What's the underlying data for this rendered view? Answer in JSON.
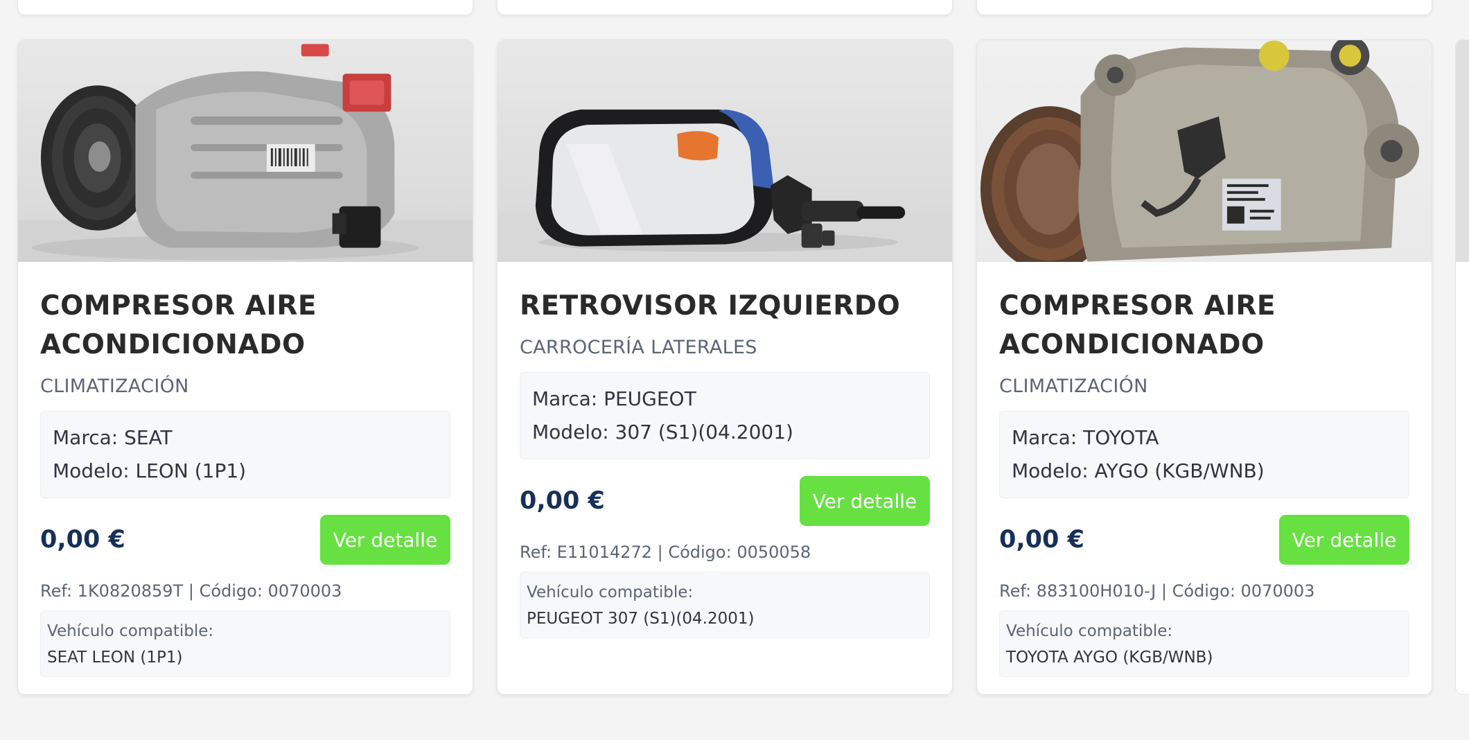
{
  "products": [
    {
      "title": "COMPRESOR AIRE ACONDICIONADO",
      "category": "CLIMATIZACIÓN",
      "brand_line": "Marca: SEAT",
      "model_line": "Modelo: LEON (1P1)",
      "price": "0,00 €",
      "button_label": "Ver detalle",
      "ref_line": "Ref: 1K0820859T | Código: 0070003",
      "compat_label": "Vehículo compatible:",
      "compat_value": "SEAT LEON (1P1)",
      "image_icon": "ac-compressor-photo"
    },
    {
      "title": "RETROVISOR IZQUIERDO",
      "category": "CARROCERÍA LATERALES",
      "brand_line": "Marca: PEUGEOT",
      "model_line": "Modelo: 307 (S1)(04.2001)",
      "price": "0,00 €",
      "button_label": "Ver detalle",
      "ref_line": "Ref: E11014272 | Código: 0050058",
      "compat_label": "Vehículo compatible:",
      "compat_value": "PEUGEOT 307 (S1)(04.2001)",
      "image_icon": "side-mirror-photo"
    },
    {
      "title": "COMPRESOR AIRE ACONDICIONADO",
      "category": "CLIMATIZACIÓN",
      "brand_line": "Marca: TOYOTA",
      "model_line": "Modelo: AYGO (KGB/WNB)",
      "price": "0,00 €",
      "button_label": "Ver detalle",
      "ref_line": "Ref: 883100H010-J | Código: 0070003",
      "compat_label": "Vehículo compatible:",
      "compat_value": "TOYOTA AYGO (KGB/WNB)",
      "image_icon": "ac-compressor-photo"
    }
  ],
  "colors": {
    "button": "#66e141",
    "price": "#16305a",
    "title": "#2a2a2a",
    "muted": "#5b6475"
  }
}
